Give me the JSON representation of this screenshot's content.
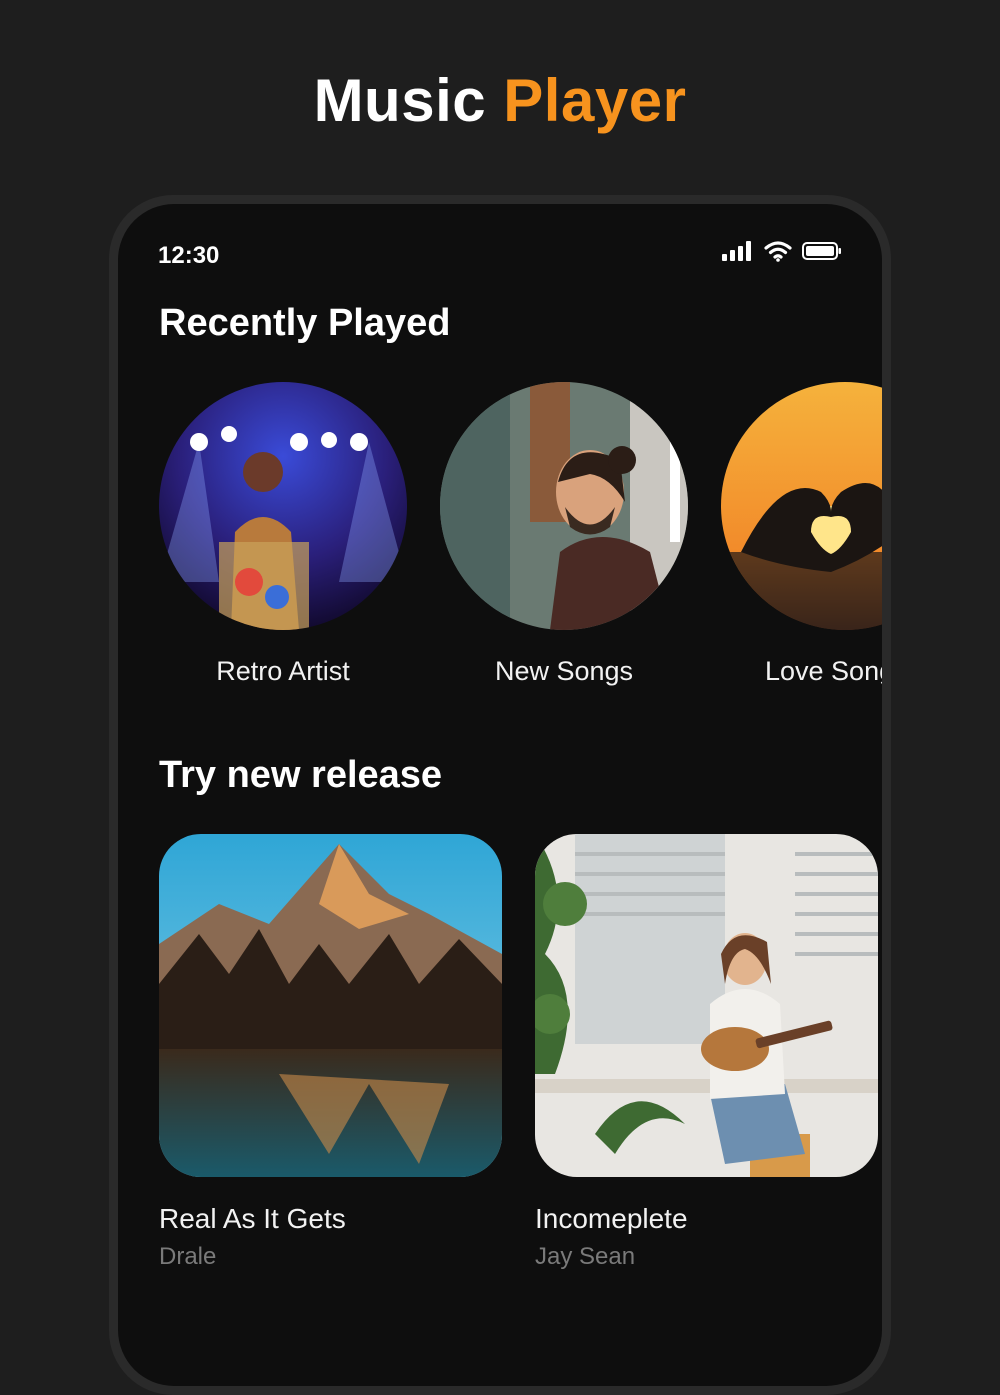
{
  "header": {
    "title_white": "Music",
    "title_accent": "Player"
  },
  "status_bar": {
    "time": "12:30"
  },
  "recently_played": {
    "title": "Recently Played",
    "items": [
      {
        "label": "Retro Artist"
      },
      {
        "label": "New Songs"
      },
      {
        "label": "Love Songs"
      }
    ]
  },
  "new_release": {
    "title": "Try new release",
    "items": [
      {
        "title": "Real As It Gets",
        "artist": "Drale"
      },
      {
        "title": "Incomeplete",
        "artist": "Jay Sean"
      }
    ]
  },
  "colors": {
    "accent": "#f7931e",
    "background": "#1e1e1e",
    "screen": "#0e0e0e",
    "muted_text": "#7a7a7a"
  },
  "icons": [
    "signal-icon",
    "wifi-icon",
    "battery-icon"
  ]
}
